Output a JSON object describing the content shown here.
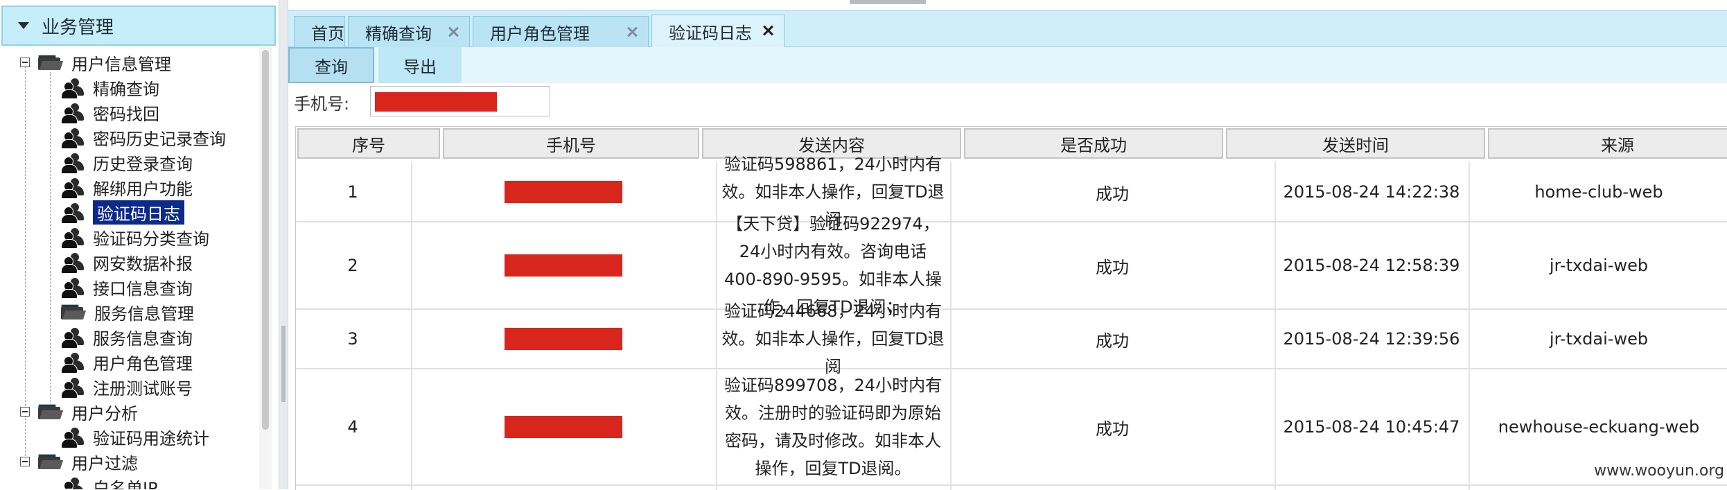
{
  "sidebar": {
    "title": "业务管理",
    "groups": [
      {
        "label": "用户信息管理",
        "items": [
          {
            "label": "精确查询",
            "icon": "users-icon"
          },
          {
            "label": "密码找回",
            "icon": "users-icon"
          },
          {
            "label": "密码历史记录查询",
            "icon": "users-icon"
          },
          {
            "label": "历史登录查询",
            "icon": "users-icon"
          },
          {
            "label": "解绑用户功能",
            "icon": "users-icon"
          },
          {
            "label": "验证码日志",
            "icon": "users-icon",
            "selected": true
          },
          {
            "label": "验证码分类查询",
            "icon": "users-icon"
          },
          {
            "label": "网安数据补报",
            "icon": "users-icon"
          },
          {
            "label": "接口信息查询",
            "icon": "users-icon"
          },
          {
            "label": "服务信息管理",
            "icon": "folder-icon"
          },
          {
            "label": "服务信息查询",
            "icon": "users-icon"
          },
          {
            "label": "用户角色管理",
            "icon": "users-icon"
          },
          {
            "label": "注册测试账号",
            "icon": "users-icon"
          }
        ]
      },
      {
        "label": "用户分析",
        "items": [
          {
            "label": "验证码用途统计",
            "icon": "users-icon"
          }
        ]
      },
      {
        "label": "用户过滤",
        "items": [
          {
            "label": "白名单IP",
            "icon": "users-icon"
          }
        ]
      }
    ]
  },
  "tabs": [
    {
      "label": "首页",
      "closable": false
    },
    {
      "label": "精确查询",
      "closable": true
    },
    {
      "label": "用户角色管理",
      "closable": true
    },
    {
      "label": "验证码日志",
      "closable": true,
      "active": true
    }
  ],
  "toolbar": {
    "query_label": "查询",
    "export_label": "导出"
  },
  "search": {
    "phone_label": "手机号:",
    "phone_value_redacted": true
  },
  "table": {
    "columns": [
      "序号",
      "手机号",
      "发送内容",
      "是否成功",
      "发送时间",
      "来源"
    ],
    "rows": [
      {
        "index": "1",
        "phone_redacted": true,
        "content": "验证码598861，24小时内有效。如非本人操作，回复TD退阅",
        "success": "成功",
        "time": "2015-08-24 14:22:38",
        "source": "home-club-web"
      },
      {
        "index": "2",
        "phone_redacted": true,
        "content": "【天下贷】验证码922974，24小时内有效。咨询电话400-890-9595。如非本人操作，回复TD退阅；",
        "success": "成功",
        "time": "2015-08-24 12:58:39",
        "source": "jr-txdai-web"
      },
      {
        "index": "3",
        "phone_redacted": true,
        "content": "验证码244668，24小时内有效。如非本人操作，回复TD退阅",
        "success": "成功",
        "time": "2015-08-24 12:39:56",
        "source": "jr-txdai-web"
      },
      {
        "index": "4",
        "phone_redacted": true,
        "content": "验证码899708，24小时内有效。注册时的验证码即为原始密码，请及时修改。如非本人操作，回复TD退阅。",
        "success": "成功",
        "time": "2015-08-24 10:45:47",
        "source": "newhouse-eckuang-web"
      }
    ]
  },
  "watermark": "www.wooyun.org",
  "colors": {
    "tab_bar": "#cdeefa",
    "selected_nav": "#0b2a8a",
    "redaction": "#d9261d"
  }
}
